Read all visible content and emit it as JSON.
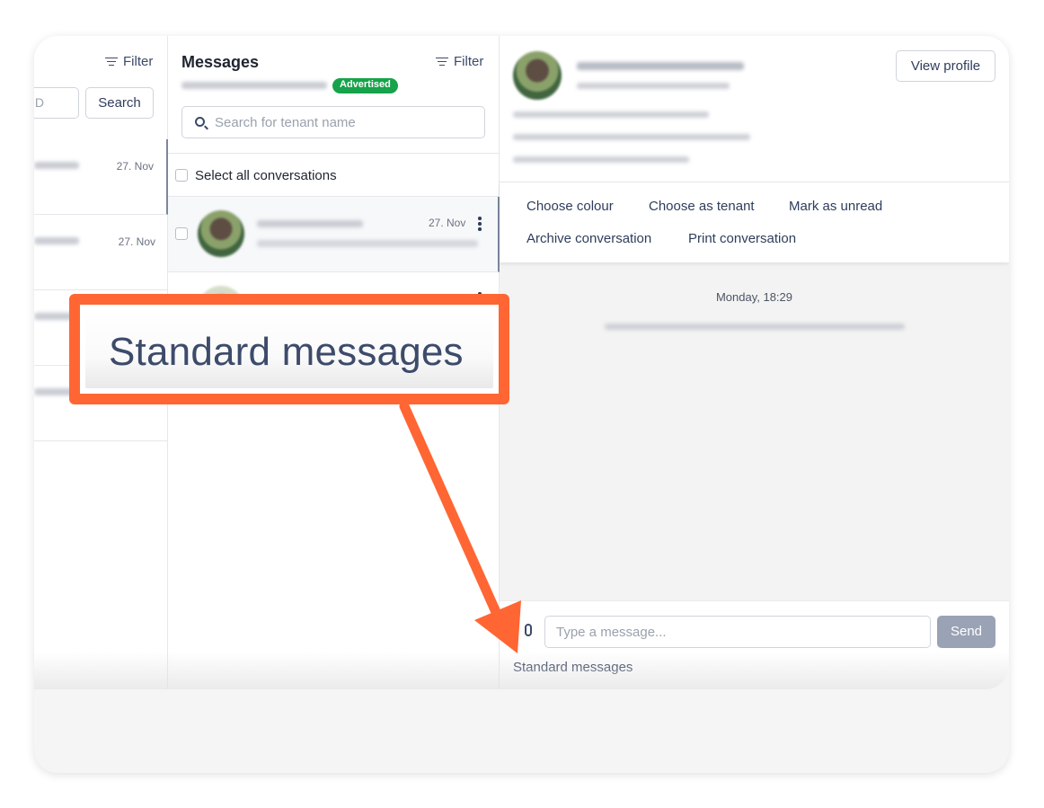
{
  "left_column": {
    "filter_label": "Filter",
    "search_input_fragment": "D",
    "search_button_label": "Search",
    "rows": [
      {
        "date": "27. Nov"
      },
      {
        "date": "27. Nov"
      },
      {
        "date": ""
      },
      {
        "date": ""
      }
    ]
  },
  "messages_column": {
    "title": "Messages",
    "filter_label": "Filter",
    "status_badge": "Advertised",
    "search_placeholder": "Search for tenant name",
    "select_all_label": "Select all conversations",
    "conversations": [
      {
        "date": "27. Nov"
      }
    ]
  },
  "conversation_panel": {
    "view_profile_label": "View profile",
    "actions": [
      "Choose colour",
      "Choose as tenant",
      "Mark as unread",
      "Archive conversation",
      "Print conversation"
    ],
    "date_separator": "Monday, 18:29",
    "message_placeholder": "Type a message...",
    "send_label": "Send",
    "standard_messages_link": "Standard messages"
  },
  "callout": {
    "text": "Standard messages",
    "accent_color": "#ff6633"
  }
}
